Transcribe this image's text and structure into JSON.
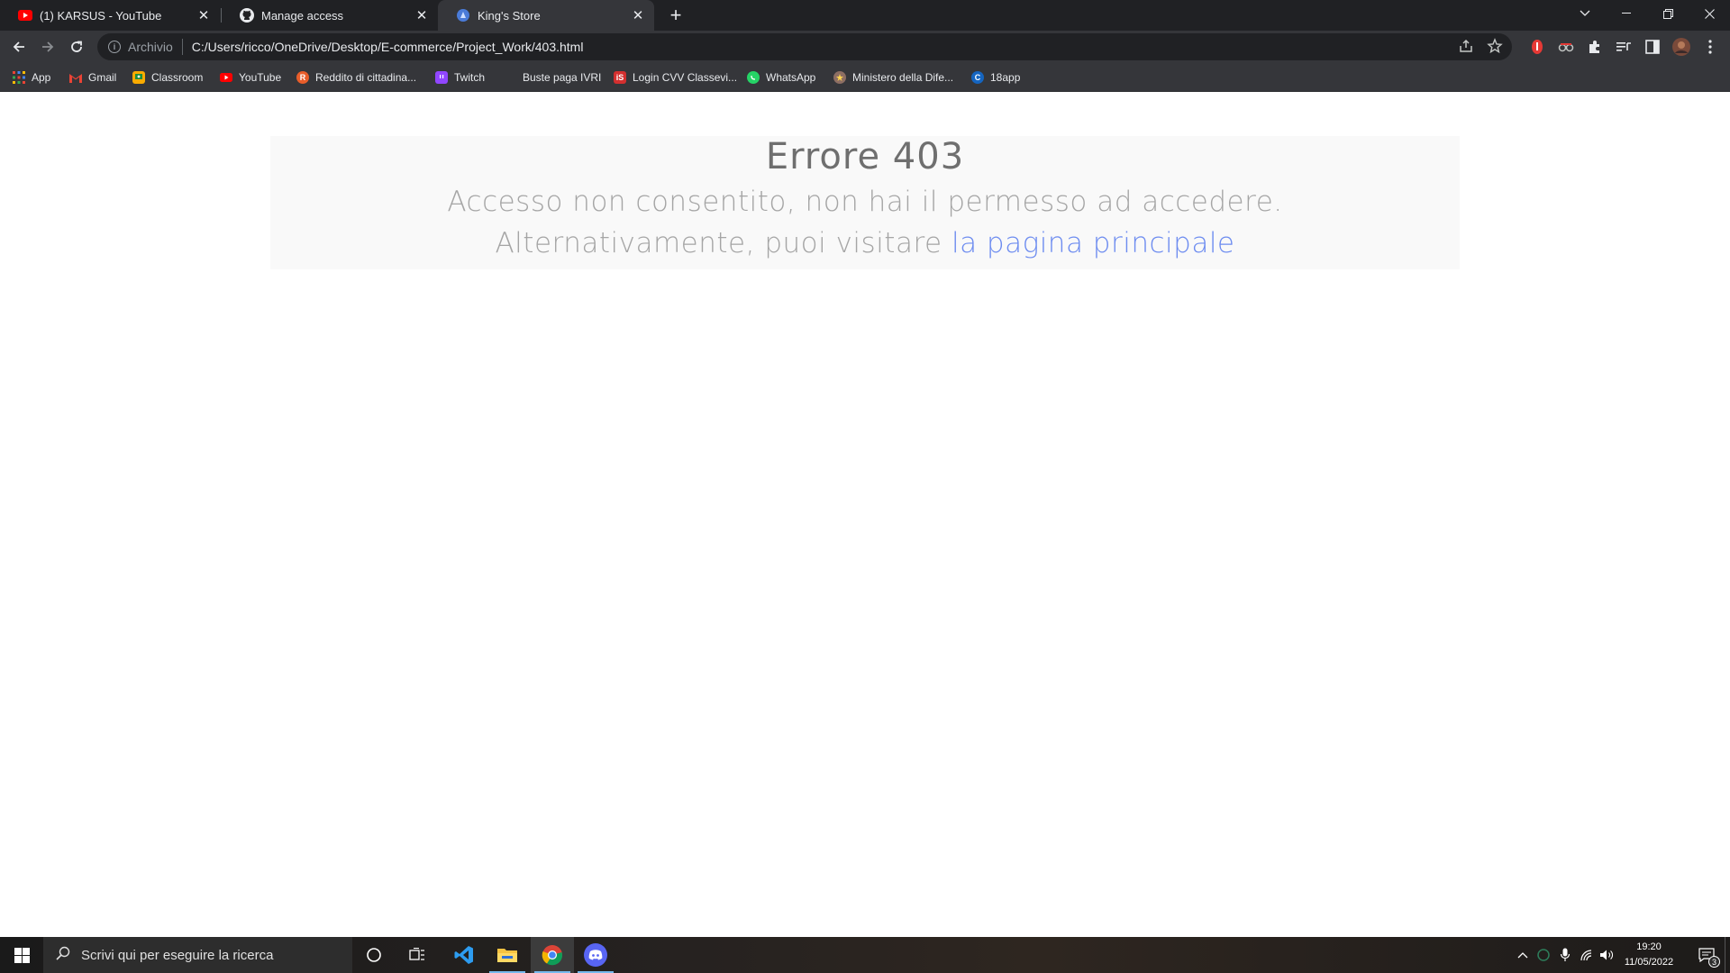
{
  "browser": {
    "tabs": [
      {
        "title": "(1) KARSUS - YouTube",
        "icon": "youtube-icon",
        "active": false
      },
      {
        "title": "Manage access",
        "icon": "github-icon",
        "active": false
      },
      {
        "title": "King's Store",
        "icon": "site-favicon-icon",
        "active": true
      }
    ],
    "address_bar": {
      "chip": "Archivio",
      "url": "C:/Users/ricco/OneDrive/Desktop/E-commerce/Project_Work/403.html"
    },
    "bookmarks": [
      {
        "label": "App",
        "icon": "apps-grid-icon"
      },
      {
        "label": "Gmail",
        "icon": "gmail-icon"
      },
      {
        "label": "Classroom",
        "icon": "classroom-icon"
      },
      {
        "label": "YouTube",
        "icon": "youtube-icon"
      },
      {
        "label": "Reddito di cittadina...",
        "icon": "reddito-icon"
      },
      {
        "label": "Twitch",
        "icon": "twitch-icon"
      },
      {
        "label": "Buste paga IVRI",
        "icon": ""
      },
      {
        "label": "Login CVV Classevi...",
        "icon": "classeviva-icon"
      },
      {
        "label": "WhatsApp",
        "icon": "whatsapp-icon"
      },
      {
        "label": "Ministero della Dife...",
        "icon": "ministero-icon"
      },
      {
        "label": "18app",
        "icon": "18app-icon"
      }
    ]
  },
  "page": {
    "title": "Errore 403",
    "line1": "Accesso non consentito, non hai il permesso ad accedere.",
    "line2_prefix": "Alternativamente, puoi visitare",
    "link_text": "la pagina principale"
  },
  "taskbar": {
    "search_placeholder": "Scrivi qui per eseguire la ricerca",
    "apps": [
      "cortana-icon",
      "task-view-icon",
      "vscode-icon",
      "file-explorer-icon",
      "chrome-icon",
      "discord-icon"
    ],
    "time": "19:20",
    "date": "11/05/2022",
    "notification_count": "3"
  },
  "colors": {
    "tabstrip": "#202124",
    "toolbar": "#35363a",
    "error_box_bg": "#f9f9f9",
    "error_title": "#6f6f6f",
    "error_text": "#a5a5a5",
    "link": "#6d8cf0"
  }
}
